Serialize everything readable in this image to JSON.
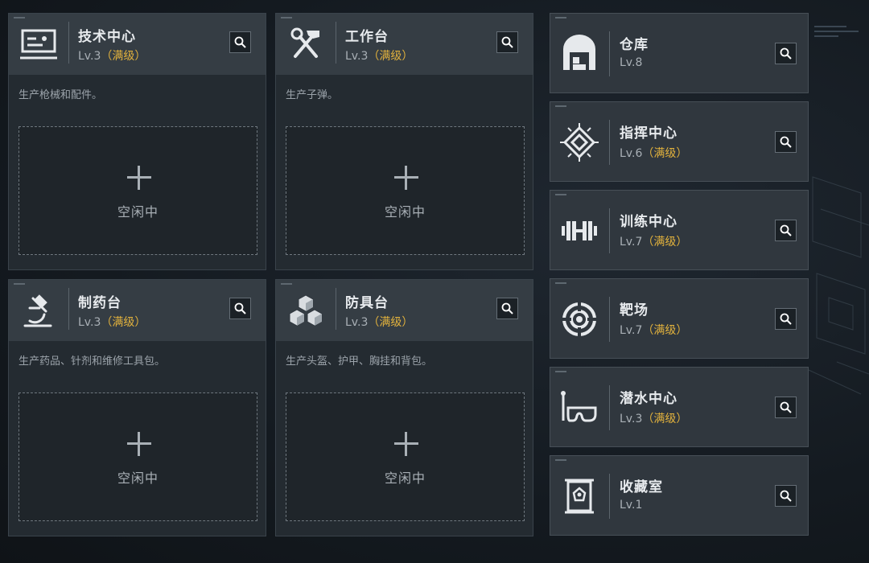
{
  "production": [
    {
      "title": "技术中心",
      "lv": "Lv.3",
      "max": "（满级）",
      "desc": "生产枪械和配件。",
      "slot": "空闲中",
      "icon": "computer-terminal-icon"
    },
    {
      "title": "工作台",
      "lv": "Lv.3",
      "max": "（满级）",
      "desc": "生产子弹。",
      "slot": "空闲中",
      "icon": "hammer-wrench-icon"
    },
    {
      "title": "制药台",
      "lv": "Lv.3",
      "max": "（满级）",
      "desc": "生产药品、针剂和维修工具包。",
      "slot": "空闲中",
      "icon": "microscope-icon"
    },
    {
      "title": "防具台",
      "lv": "Lv.3",
      "max": "（满级）",
      "desc": "生产头盔、护甲、胸挂和背包。",
      "slot": "空闲中",
      "icon": "stacked-cubes-icon"
    }
  ],
  "facilities": [
    {
      "title": "仓库",
      "lv": "Lv.8",
      "max": "",
      "icon": "warehouse-icon"
    },
    {
      "title": "指挥中心",
      "lv": "Lv.6",
      "max": "（满级）",
      "icon": "chip-diamond-icon"
    },
    {
      "title": "训练中心",
      "lv": "Lv.7",
      "max": "（满级）",
      "icon": "dumbbell-icon"
    },
    {
      "title": "靶场",
      "lv": "Lv.7",
      "max": "（满级）",
      "icon": "target-icon"
    },
    {
      "title": "潜水中心",
      "lv": "Lv.3",
      "max": "（满级）",
      "icon": "diving-mask-icon"
    },
    {
      "title": "收藏室",
      "lv": "Lv.1",
      "max": "",
      "icon": "display-case-icon"
    }
  ],
  "colors": {
    "accent_max": "#e2b23d",
    "card_bg": "#242b31",
    "header_bg": "#353d44"
  }
}
